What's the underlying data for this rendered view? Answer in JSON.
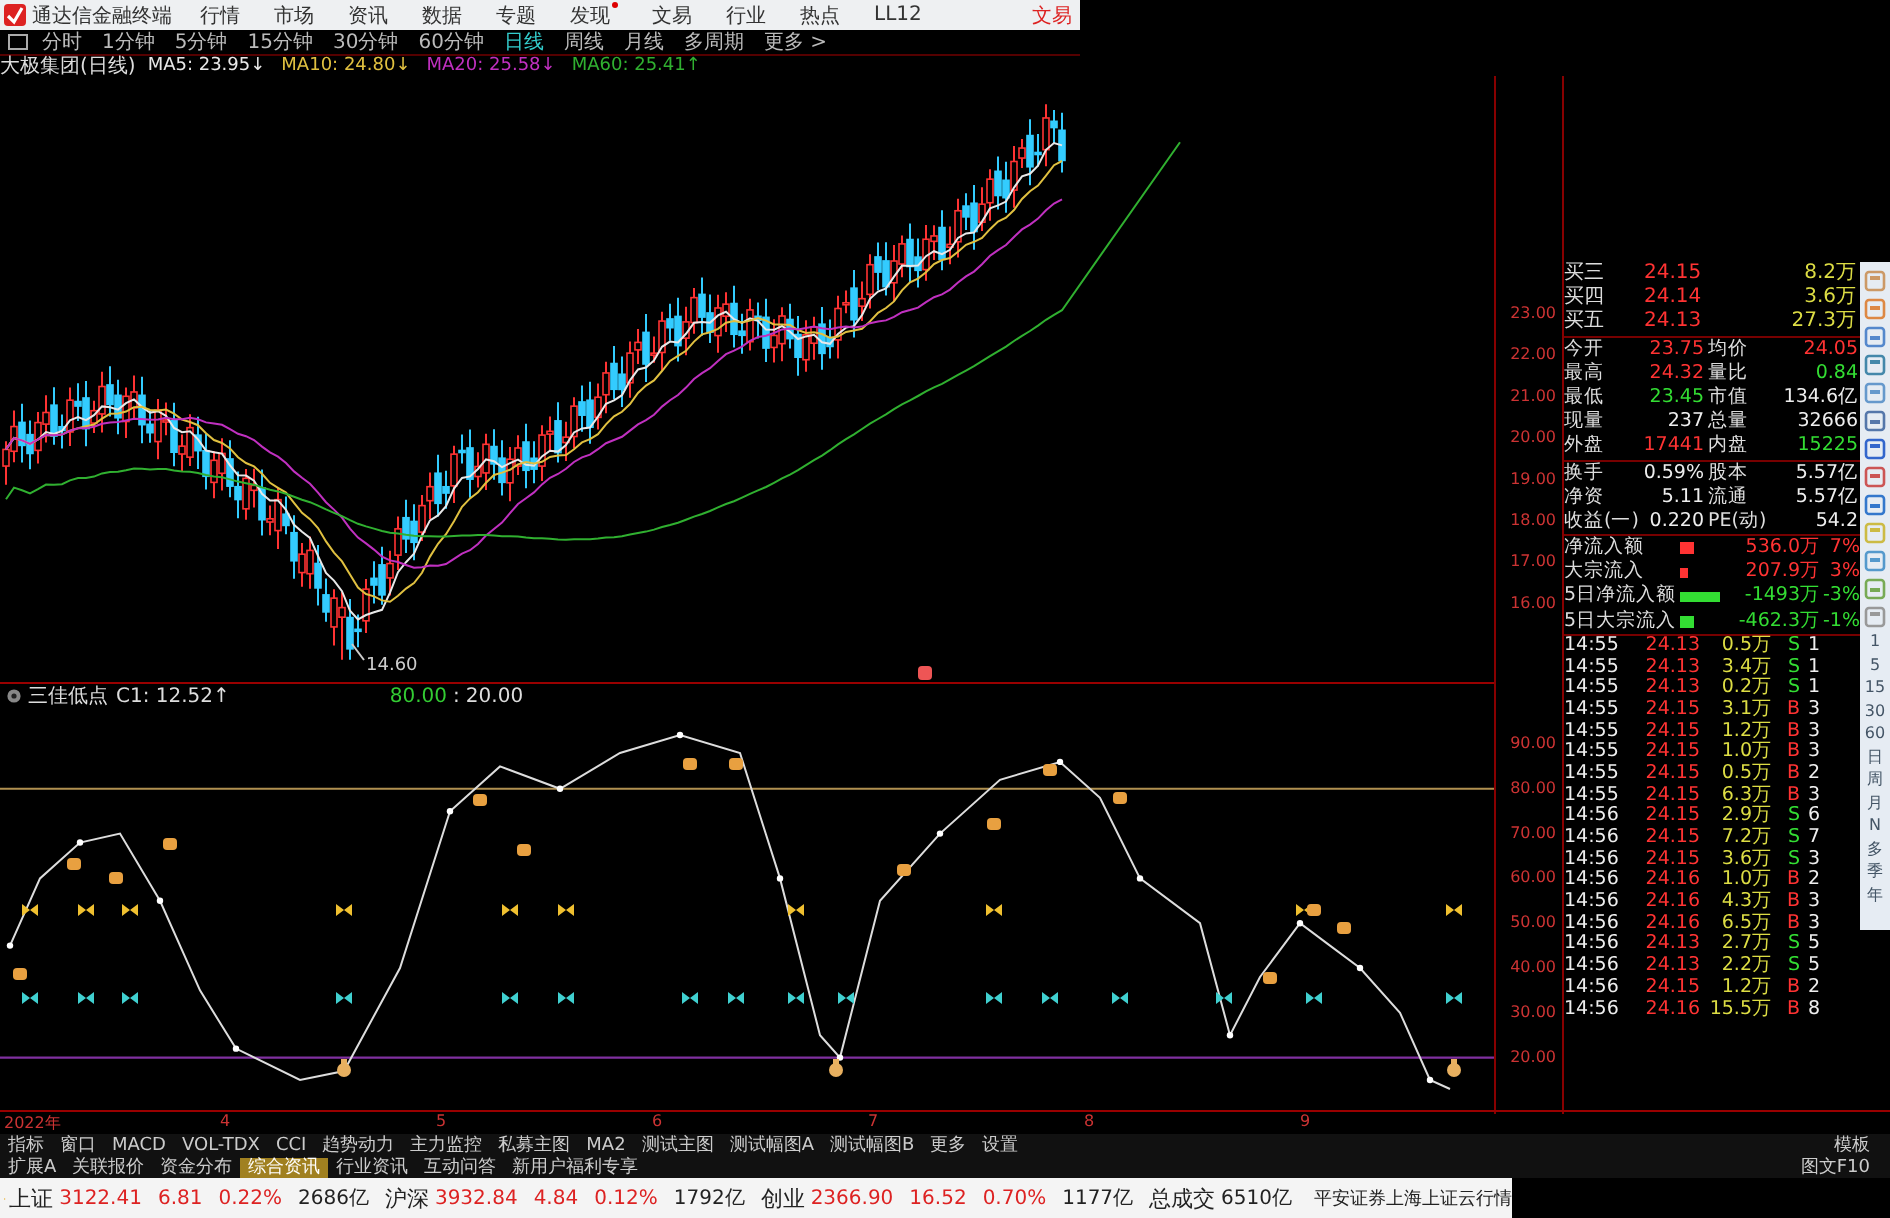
{
  "menu_bar": {
    "title": "通达信金融终端",
    "items": [
      {
        "label": "行情",
        "dot": false
      },
      {
        "label": "市场",
        "dot": false
      },
      {
        "label": "资讯",
        "dot": false
      },
      {
        "label": "数据",
        "dot": false
      },
      {
        "label": "专题",
        "dot": false
      },
      {
        "label": "发现",
        "dot": true
      },
      {
        "label": "文易",
        "dot": false
      },
      {
        "label": "行业",
        "dot": false
      },
      {
        "label": "热点",
        "dot": false
      },
      {
        "label": "LL12",
        "dot": false
      }
    ],
    "trade": "文易"
  },
  "periods": [
    {
      "label": "分时",
      "selected": false
    },
    {
      "label": "1分钟",
      "selected": false
    },
    {
      "label": "5分钟",
      "selected": false
    },
    {
      "label": "15分钟",
      "selected": false
    },
    {
      "label": "30分钟",
      "selected": false
    },
    {
      "label": "60分钟",
      "selected": false
    },
    {
      "label": "日线",
      "selected": true
    },
    {
      "label": "周线",
      "selected": false
    },
    {
      "label": "月线",
      "selected": false
    },
    {
      "label": "多周期",
      "selected": false
    },
    {
      "label": "更多 >",
      "selected": false
    }
  ],
  "ma_legend": {
    "title": "大极集团(日线)",
    "items": [
      {
        "label": "MA5: 23.95↓",
        "color": "#e8e8e8"
      },
      {
        "label": "MA10: 24.80↓",
        "color": "#e0c040"
      },
      {
        "label": "MA20: 25.58↓",
        "color": "#c030c0"
      },
      {
        "label": "MA60: 25.41↑",
        "color": "#30b030"
      }
    ]
  },
  "price_axis": [
    "23.00",
    "22.00",
    "21.00",
    "20.00",
    "19.00",
    "18.00",
    "17.00",
    "16.00"
  ],
  "low_label": "14.60",
  "indicator": {
    "title": "三佳低点",
    "value": "C1: 12.52↑",
    "upper": "80.00",
    "separator": ":",
    "lower": "20.00",
    "axis": [
      "90.00",
      "80.00",
      "70.00",
      "60.00",
      "50.00",
      "40.00",
      "30.00",
      "20.00"
    ]
  },
  "quote_panel": {
    "depth": [
      {
        "label": "买三",
        "price": "24.15",
        "volume": "8.2万"
      },
      {
        "label": "买四",
        "price": "24.14",
        "volume": "3.6万"
      },
      {
        "label": "买五",
        "price": "24.13",
        "volume": "27.3万"
      }
    ],
    "stats": [
      {
        "label": "今开",
        "value": "23.75",
        "color": "#ff3333"
      },
      {
        "label": "均价",
        "value": "24.05",
        "color": "#ff3333"
      },
      {
        "label": "最高",
        "value": "24.32",
        "color": "#ff3333"
      },
      {
        "label": "量比",
        "value": "0.84",
        "color": "#33dd33"
      },
      {
        "label": "最低",
        "value": "23.45",
        "color": "#33dd33"
      },
      {
        "label": "市值",
        "value": "134.6亿",
        "color": "#eeeeee"
      },
      {
        "label": "现量",
        "value": "237",
        "color": "#eeeeee"
      },
      {
        "label": "总量",
        "value": "32666",
        "color": "#eeeeee"
      },
      {
        "label": "外盘",
        "value": "17441",
        "color": "#ff3333"
      },
      {
        "label": "内盘",
        "value": "15225",
        "color": "#33dd33"
      }
    ],
    "stats2": [
      {
        "label": "换手",
        "value": "0.59%",
        "color": "#eeeeee"
      },
      {
        "label": "股本",
        "value": "5.57亿",
        "color": "#eeeeee"
      },
      {
        "label": "净资",
        "value": "5.11",
        "color": "#eeeeee"
      },
      {
        "label": "流通",
        "value": "5.57亿",
        "color": "#eeeeee"
      },
      {
        "label": "收益(一)",
        "value": "0.220",
        "color": "#eeeeee"
      },
      {
        "label": "PE(动)",
        "value": "54.2",
        "color": "#eeeeee"
      }
    ],
    "flows": [
      {
        "label": "净流入额",
        "kind": "square",
        "value": "536.0万",
        "percent": "7%",
        "color": "#ff3333"
      },
      {
        "label": "大宗流入",
        "kind": "dot",
        "value": "207.9万",
        "percent": "3%",
        "color": "#ff3333"
      },
      {
        "label": "5日净流入额",
        "kind": "bar",
        "value": "-1493万",
        "percent": "-3%",
        "color": "#33dd33"
      },
      {
        "label": "5日大宗流入",
        "kind": "square",
        "value": "-462.3万",
        "percent": "-1%",
        "color": "#33dd33"
      }
    ],
    "ticks": [
      {
        "time": "14:55",
        "price": "24.13",
        "volume": "0.5万",
        "side": "S",
        "count": "1",
        "color": "#33dd33"
      },
      {
        "time": "14:55",
        "price": "24.13",
        "volume": "3.4万",
        "side": "S",
        "count": "1",
        "color": "#33dd33"
      },
      {
        "time": "14:55",
        "price": "24.13",
        "volume": "0.2万",
        "side": "S",
        "count": "1",
        "color": "#33dd33"
      },
      {
        "time": "14:55",
        "price": "24.15",
        "volume": "3.1万",
        "side": "B",
        "count": "3",
        "color": "#ff3333"
      },
      {
        "time": "14:55",
        "price": "24.15",
        "volume": "1.2万",
        "side": "B",
        "count": "3",
        "color": "#ff3333"
      },
      {
        "time": "14:55",
        "price": "24.15",
        "volume": "1.0万",
        "side": "B",
        "count": "3",
        "color": "#ff3333"
      },
      {
        "time": "14:55",
        "price": "24.15",
        "volume": "0.5万",
        "side": "B",
        "count": "2",
        "color": "#ff3333"
      },
      {
        "time": "14:55",
        "price": "24.15",
        "volume": "6.3万",
        "side": "B",
        "count": "3",
        "color": "#ff3333"
      },
      {
        "time": "14:56",
        "price": "24.15",
        "volume": "2.9万",
        "side": "S",
        "count": "6",
        "color": "#33dd33"
      },
      {
        "time": "14:56",
        "price": "24.15",
        "volume": "7.2万",
        "side": "S",
        "count": "7",
        "color": "#33dd33"
      },
      {
        "time": "14:56",
        "price": "24.15",
        "volume": "3.6万",
        "side": "S",
        "count": "3",
        "color": "#33dd33"
      },
      {
        "time": "14:56",
        "price": "24.16",
        "volume": "1.0万",
        "side": "B",
        "count": "2",
        "color": "#ff3333"
      },
      {
        "time": "14:56",
        "price": "24.16",
        "volume": "4.3万",
        "side": "B",
        "count": "3",
        "color": "#ff3333"
      },
      {
        "time": "14:56",
        "price": "24.16",
        "volume": "6.5万",
        "side": "B",
        "count": "3",
        "color": "#ff3333"
      },
      {
        "time": "14:56",
        "price": "24.13",
        "volume": "2.7万",
        "side": "S",
        "count": "5",
        "color": "#33dd33"
      },
      {
        "time": "14:56",
        "price": "24.13",
        "volume": "2.2万",
        "side": "S",
        "count": "5",
        "color": "#33dd33"
      },
      {
        "time": "14:56",
        "price": "24.15",
        "volume": "1.2万",
        "side": "B",
        "count": "2",
        "color": "#ff3333"
      },
      {
        "time": "14:56",
        "price": "24.16",
        "volume": "15.5万",
        "side": "B",
        "count": "8",
        "color": "#ff3333"
      }
    ]
  },
  "side_periods": [
    "1",
    "5",
    "15",
    "30",
    "60",
    "日",
    "周",
    "月",
    "N",
    "多",
    "季",
    "年"
  ],
  "dates": [
    "2022年",
    "4",
    "5",
    "6",
    "7",
    "8",
    "9"
  ],
  "tabs": [
    {
      "label": "指标",
      "selected": false
    },
    {
      "label": "窗口",
      "selected": false
    },
    {
      "label": "MACD",
      "selected": false
    },
    {
      "label": "VOL-TDX",
      "selected": false
    },
    {
      "label": "CCI",
      "selected": false
    },
    {
      "label": "趋势动力",
      "selected": false
    },
    {
      "label": "主力监控",
      "selected": false
    },
    {
      "label": "私募主图",
      "selected": false
    },
    {
      "label": "MA2",
      "selected": false
    },
    {
      "label": "测试主图",
      "selected": false
    },
    {
      "label": "测试幅图A",
      "selected": false
    },
    {
      "label": "测试幅图B",
      "selected": false
    },
    {
      "label": "更多",
      "selected": false
    },
    {
      "label": "设置",
      "selected": false
    }
  ],
  "tabs_right": "模板",
  "info_tabs": [
    {
      "label": "扩展A",
      "selected": false
    },
    {
      "label": "关联报价",
      "selected": false
    },
    {
      "label": "资金分布",
      "selected": false
    },
    {
      "label": "综合资讯",
      "selected": true
    },
    {
      "label": "行业资讯",
      "selected": false
    },
    {
      "label": "互动问答",
      "selected": false
    },
    {
      "label": "新用户福利专享",
      "selected": false
    }
  ],
  "info_right": "图文F10",
  "status_bar": {
    "indices": [
      {
        "label": "上证",
        "value": "3122.41",
        "change": "6.81",
        "percent": "0.22%",
        "amount": "2686亿",
        "color": "#dd2222"
      },
      {
        "label": "沪深",
        "value": "3932.84",
        "change": "4.84",
        "percent": "0.12%",
        "amount": "1792亿",
        "color": "#dd2222"
      },
      {
        "label": "创业",
        "value": "2366.90",
        "change": "16.52",
        "percent": "0.70%",
        "amount": "1177亿",
        "color": "#dd2222"
      }
    ],
    "total_label": "总成交",
    "total_value": "6510亿",
    "source": "平安证券上海上证云行情"
  }
}
